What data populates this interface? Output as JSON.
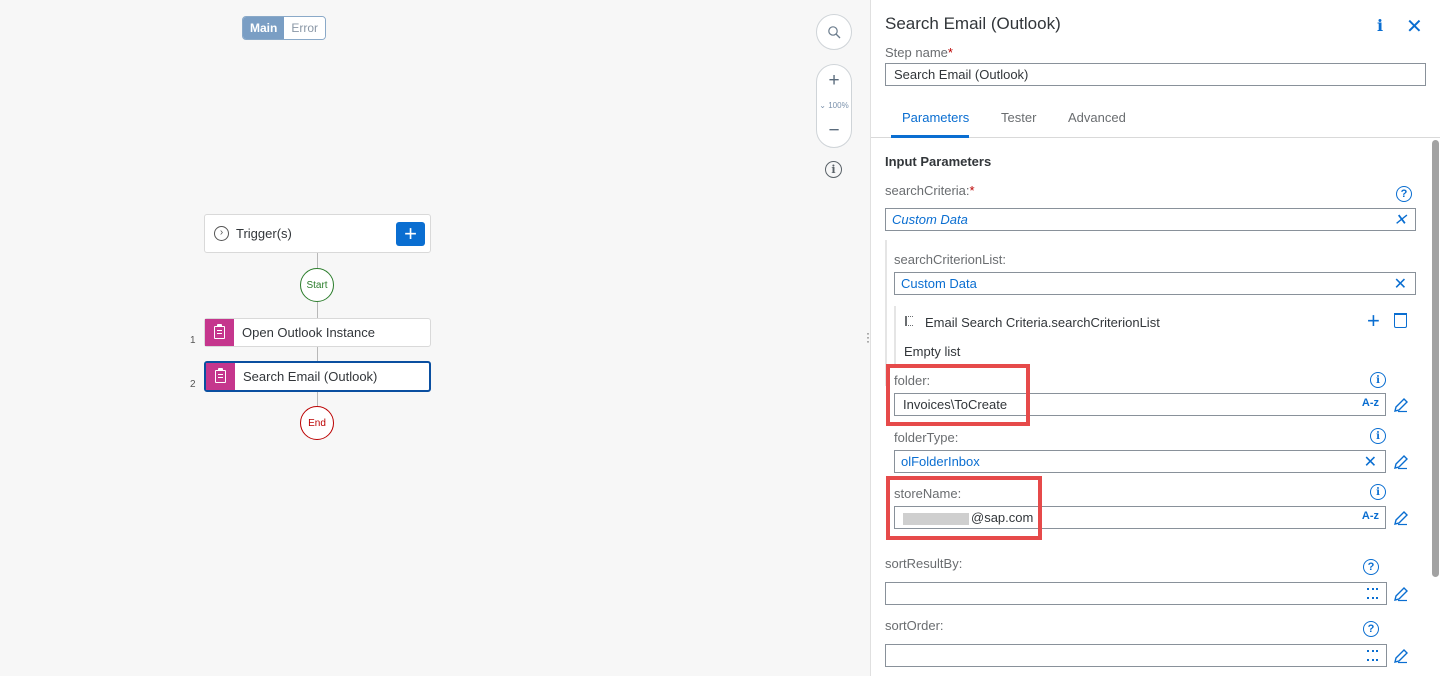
{
  "canvas": {
    "branches": {
      "main": "Main",
      "error": "Error"
    },
    "zoom_level": "100%",
    "trigger_label": "Trigger(s)",
    "start_label": "Start",
    "end_label": "End",
    "steps": [
      {
        "number": "1",
        "label": "Open Outlook Instance"
      },
      {
        "number": "2",
        "label": "Search Email (Outlook)"
      }
    ]
  },
  "panel": {
    "title": "Search Email (Outlook)",
    "step_name_label": "Step name",
    "step_name_value": "Search Email (Outlook)",
    "tabs": [
      "Parameters",
      "Tester",
      "Advanced"
    ],
    "active_tab": "Parameters",
    "section_title": "Input Parameters",
    "fields": {
      "searchCriteria": {
        "label": "searchCriteria:",
        "value": "Custom Data"
      },
      "searchCriterionList": {
        "label": "searchCriterionList:",
        "value": "Custom Data"
      },
      "list_name": "Email Search Criteria.searchCriterionList",
      "empty_list": "Empty list",
      "folder": {
        "label": "folder:",
        "value": "Invoices\\ToCreate"
      },
      "folderType": {
        "label": "folderType:",
        "value": "olFolderInbox"
      },
      "storeName": {
        "label": "storeName:",
        "value": "@sap.com"
      },
      "sortResultBy": {
        "label": "sortResultBy:",
        "value": ""
      },
      "sortOrder": {
        "label": "sortOrder:",
        "value": ""
      }
    },
    "az_label": "A-z"
  },
  "colors": {
    "accent": "#0a6ed1",
    "highlight": "#e64a4a",
    "step_icon": "#c5368d"
  }
}
